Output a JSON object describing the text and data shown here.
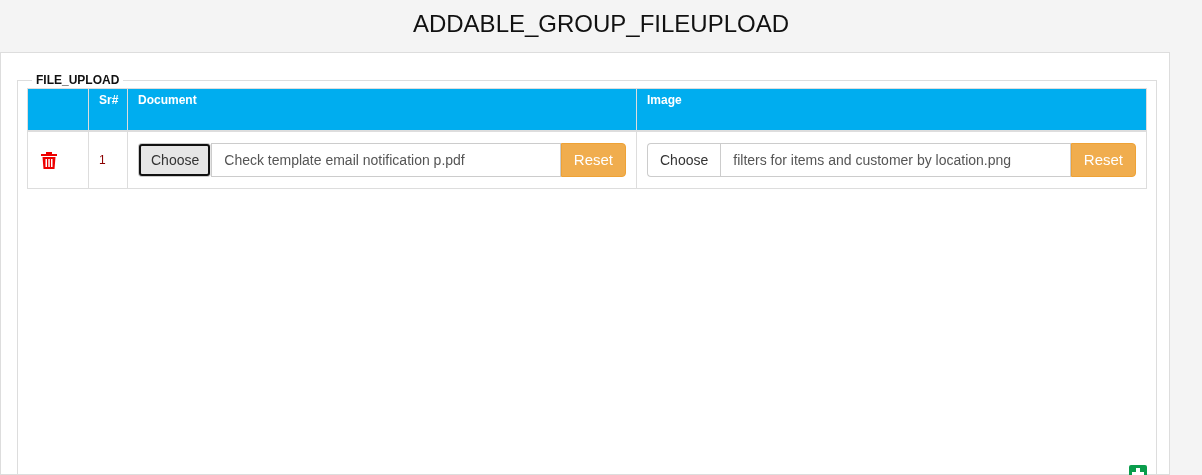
{
  "title": "ADDABLE_GROUP_FILEUPLOAD",
  "group": {
    "legend": "FILE_UPLOAD",
    "columns": [
      "",
      "Sr#",
      "Document",
      "Image"
    ],
    "rows": [
      {
        "sr": "1",
        "files": [
          {
            "choose": "Choose",
            "file_name": "Check template email notification p.pdf",
            "reset": "Reset",
            "focused": true
          },
          {
            "choose": "Choose",
            "file_name": "filters for items and customer by location.png",
            "reset": "Reset",
            "focused": false
          }
        ]
      }
    ]
  }
}
